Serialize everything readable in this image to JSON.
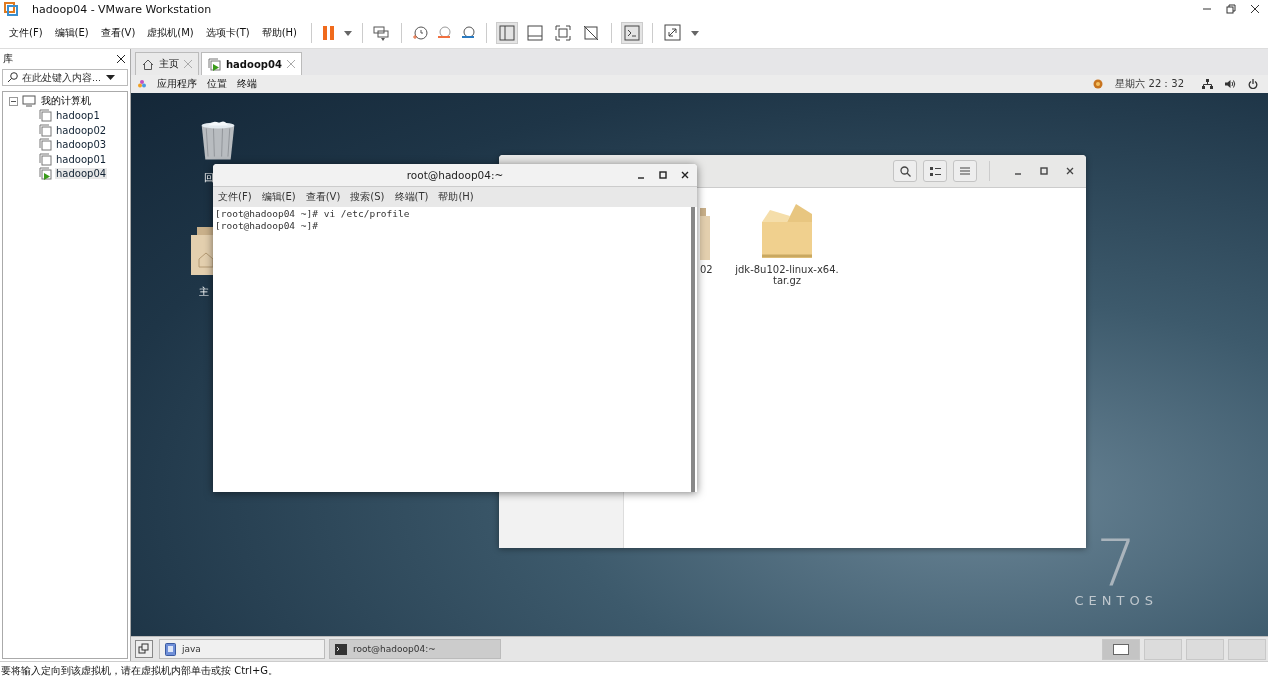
{
  "window": {
    "title": "hadoop04 - VMware Workstation"
  },
  "menu": [
    "文件(F)",
    "编辑(E)",
    "查看(V)",
    "虚拟机(M)",
    "选项卡(T)",
    "帮助(H)"
  ],
  "library": {
    "title": "库",
    "search": {
      "placeholder": "在此处键入内容..."
    },
    "tree": [
      {
        "label": "我的计算机",
        "expanded": true,
        "children": [
          {
            "label": "hadoop1",
            "selected": false,
            "running": false
          },
          {
            "label": "hadoop02",
            "selected": false,
            "running": false
          },
          {
            "label": "hadoop03",
            "selected": false,
            "running": false
          },
          {
            "label": "hadoop01",
            "selected": false,
            "running": false
          },
          {
            "label": "hadoop04",
            "selected": true,
            "running": true
          }
        ]
      }
    ]
  },
  "tabs": [
    {
      "label": "主页",
      "kind": "home",
      "selected": false
    },
    {
      "label": "hadoop04",
      "kind": "vm",
      "selected": true
    }
  ],
  "guest": {
    "top_menu": [
      "应用程序",
      "位置",
      "终端"
    ],
    "clock": "星期六  22：32",
    "desktop_icons": [
      {
        "label": "回",
        "kind": "trash"
      },
      {
        "label": "主",
        "kind": "home-folder"
      }
    ],
    "files": {
      "items": [
        {
          "label": "02",
          "kind": "folder"
        },
        {
          "label": "jdk-8u102-linux-x64.\ntar.gz",
          "kind": "archive"
        }
      ]
    },
    "terminal": {
      "title": "root@hadoop04:~",
      "menu": [
        "文件(F)",
        "编辑(E)",
        "查看(V)",
        "搜索(S)",
        "终端(T)",
        "帮助(H)"
      ],
      "lines": [
        "[root@hadoop04 ~]# vi /etc/profile",
        "[root@hadoop04 ~]# "
      ]
    },
    "brand": {
      "number": "7",
      "name": "CENTOS"
    },
    "taskbar": [
      {
        "label": "java",
        "kind": "app",
        "selected": false
      },
      {
        "label": "root@hadoop04:~",
        "kind": "terminal",
        "selected": true
      }
    ],
    "workspaces": [
      {
        "selected": true
      },
      {
        "selected": false
      },
      {
        "selected": false
      },
      {
        "selected": false
      }
    ]
  },
  "status_bar": "要将输入定向到该虚拟机，请在虚拟机内部单击或按 Ctrl+G。"
}
